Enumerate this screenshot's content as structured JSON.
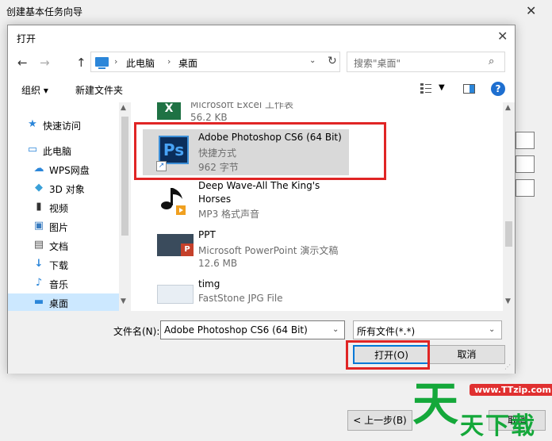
{
  "wizard": {
    "title": "创建基本任务向导",
    "close": "✕",
    "prev_button": "< 上一步(B)",
    "cancel_button": "取消"
  },
  "dialog": {
    "title": "打开",
    "close": "✕",
    "nav": {
      "back": "←",
      "forward": "→",
      "up": "↑"
    },
    "address": {
      "segments": [
        "此电脑",
        "桌面"
      ],
      "separator": "›"
    },
    "search": {
      "placeholder": "搜索\"桌面\""
    },
    "toolbar": {
      "organize": "组织 ▾",
      "new_folder": "新建文件夹",
      "help": "?"
    },
    "nav_pane": {
      "items": [
        {
          "label": "快速访问",
          "icon": "star-icon",
          "glyph": "★"
        },
        {
          "label": "此电脑",
          "icon": "computer-icon",
          "glyph": "▭"
        },
        {
          "label": "WPS网盘",
          "icon": "cloud-icon",
          "glyph": "☁"
        },
        {
          "label": "3D 对象",
          "icon": "cube-icon",
          "glyph": "◆"
        },
        {
          "label": "视频",
          "icon": "video-icon",
          "glyph": "▮"
        },
        {
          "label": "图片",
          "icon": "picture-icon",
          "glyph": "▣"
        },
        {
          "label": "文档",
          "icon": "document-icon",
          "glyph": "▤"
        },
        {
          "label": "下载",
          "icon": "download-icon",
          "glyph": "↓"
        },
        {
          "label": "音乐",
          "icon": "music-icon",
          "glyph": "♪"
        },
        {
          "label": "桌面",
          "icon": "desktop-icon",
          "glyph": "▬"
        }
      ],
      "selected": "桌面"
    },
    "files": [
      {
        "name": "Microsoft Excel 工作表",
        "sub": "56.2 KB"
      },
      {
        "name": "Adobe Photoshop CS6 (64 Bit)",
        "type": "快捷方式",
        "size": "962 字节",
        "icon_text": "Ps"
      },
      {
        "name": "Deep Wave-All The King's",
        "name2": "Horses",
        "type": "MP3 格式声音"
      },
      {
        "name": "PPT",
        "type": "Microsoft PowerPoint 演示文稿",
        "size": "12.6 MB"
      },
      {
        "name": "timg",
        "type": "FastStone JPG File"
      }
    ],
    "filename_label": "文件名(N):",
    "filename_value": "Adobe Photoshop CS6 (64 Bit)",
    "filetype_value": "所有文件(*.*)",
    "open_button": "打开(O)",
    "cancel_button": "取消"
  },
  "watermark": {
    "big": "天",
    "small": "天下载",
    "url": "www.TTzip.com"
  },
  "colors": {
    "highlight": "#e02525",
    "selection": "#cce8ff",
    "accent": "#0078d7"
  }
}
